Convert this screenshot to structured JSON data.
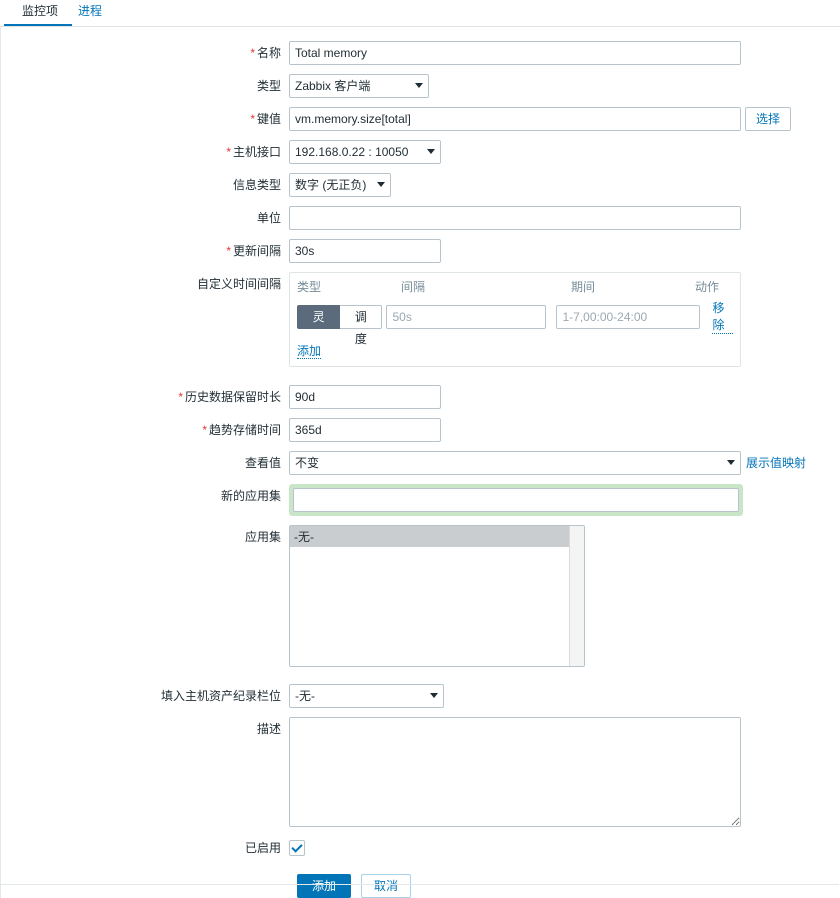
{
  "tabs": [
    {
      "label": "监控项",
      "active": true
    },
    {
      "label": "进程",
      "active": false
    }
  ],
  "form": {
    "name": {
      "label": "名称",
      "required": true,
      "value": "Total memory"
    },
    "type": {
      "label": "类型",
      "required": false,
      "value": "Zabbix 客户端"
    },
    "key": {
      "label": "键值",
      "required": true,
      "value": "vm.memory.size[total]",
      "select_button": "选择"
    },
    "host_interface": {
      "label": "主机接口",
      "required": true,
      "value": "192.168.0.22 : 10050"
    },
    "value_type": {
      "label": "信息类型",
      "required": false,
      "value": "数字 (无正负)"
    },
    "units": {
      "label": "单位",
      "required": false,
      "value": "",
      "placeholder": ""
    },
    "update_interval": {
      "label": "更新间隔",
      "required": true,
      "value": "30s"
    },
    "custom_intervals": {
      "label": "自定义时间间隔",
      "headers": {
        "type": "类型",
        "interval": "间隔",
        "period": "期间",
        "action": "动作"
      },
      "rows": [
        {
          "type_options": [
            "灵活",
            "调度"
          ],
          "type_selected": "灵活",
          "interval_value": "",
          "interval_placeholder": "50s",
          "period_value": "",
          "period_placeholder": "1-7,00:00-24:00",
          "remove_label": "移除"
        }
      ],
      "add_label": "添加"
    },
    "history": {
      "label": "历史数据保留时长",
      "required": true,
      "value": "90d"
    },
    "trends": {
      "label": "趋势存储时间",
      "required": true,
      "value": "365d"
    },
    "show_value": {
      "label": "查看值",
      "required": false,
      "value": "不变",
      "link_label": "展示值映射"
    },
    "new_application": {
      "label": "新的应用集",
      "required": false,
      "value": "",
      "placeholder": "",
      "highlight_color": "#c9e6c9"
    },
    "applications": {
      "label": "应用集",
      "required": false,
      "options": [
        "-无-"
      ],
      "selected": "-无-"
    },
    "inventory_field": {
      "label": "填入主机资产纪录栏位",
      "required": false,
      "value": "-无-"
    },
    "description": {
      "label": "描述",
      "required": false,
      "value": "",
      "placeholder": ""
    },
    "enabled": {
      "label": "已启用",
      "checked": true
    }
  },
  "footer": {
    "submit_label": "添加",
    "cancel_label": "取消"
  },
  "theme": {
    "accent": "#0275b8",
    "required_marker": "#e33734",
    "toggle_active_bg": "#5b6b7b",
    "highlight_green": "#c9e6c9"
  }
}
